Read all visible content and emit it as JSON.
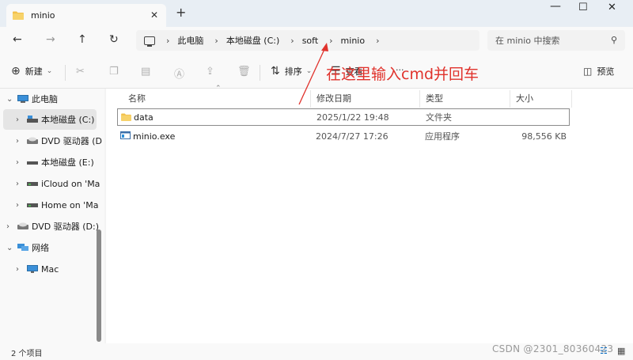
{
  "window": {
    "tab_title": "minio",
    "tab_close": "✕",
    "new_tab": "+",
    "minimize": "—",
    "maximize": "☐",
    "close": "✕"
  },
  "nav": {
    "back": "←",
    "forward": "→",
    "up": "↑",
    "refresh": "↻",
    "breadcrumbs": [
      "此电脑",
      "本地磁盘 (C:)",
      "soft",
      "minio"
    ],
    "search_placeholder": "在 minio 中搜索"
  },
  "commands": {
    "new_label": "新建",
    "sort_label": "排序",
    "view_label": "查看",
    "more": "···",
    "preview_label": "预览"
  },
  "tree": [
    {
      "label": "此电脑",
      "icon": "pc-icon"
    },
    {
      "label": "本地磁盘 (C:)",
      "icon": "drive-icon"
    },
    {
      "label": "DVD 驱动器 (D",
      "icon": "dvd-icon"
    },
    {
      "label": "本地磁盘 (E:)",
      "icon": "drive-icon"
    },
    {
      "label": "iCloud on 'Ma",
      "icon": "network-drive-icon"
    },
    {
      "label": "Home on 'Ma",
      "icon": "network-drive-icon"
    },
    {
      "label": "DVD 驱动器 (D:)",
      "icon": "dvd-icon"
    },
    {
      "label": "网络",
      "icon": "network-icon"
    },
    {
      "label": "Mac",
      "icon": "monitor-icon"
    }
  ],
  "columns": {
    "name": "名称",
    "modified": "修改日期",
    "type": "类型",
    "size": "大小"
  },
  "files": [
    {
      "name": "data",
      "modified": "2025/1/22 19:48",
      "type": "文件夹",
      "size": "",
      "icon": "folder-icon"
    },
    {
      "name": "minio.exe",
      "modified": "2024/7/27 17:26",
      "type": "应用程序",
      "size": "98,556 KB",
      "icon": "exe-icon"
    }
  ],
  "status": {
    "item_count": "2 个项目"
  },
  "annotation": {
    "text": "在这里输入cmd并回车"
  },
  "watermark": "CSDN @2301_80360423",
  "colors": {
    "accent": "#0067c0",
    "folder": "#f2c04a",
    "annotation": "#e0322c"
  }
}
